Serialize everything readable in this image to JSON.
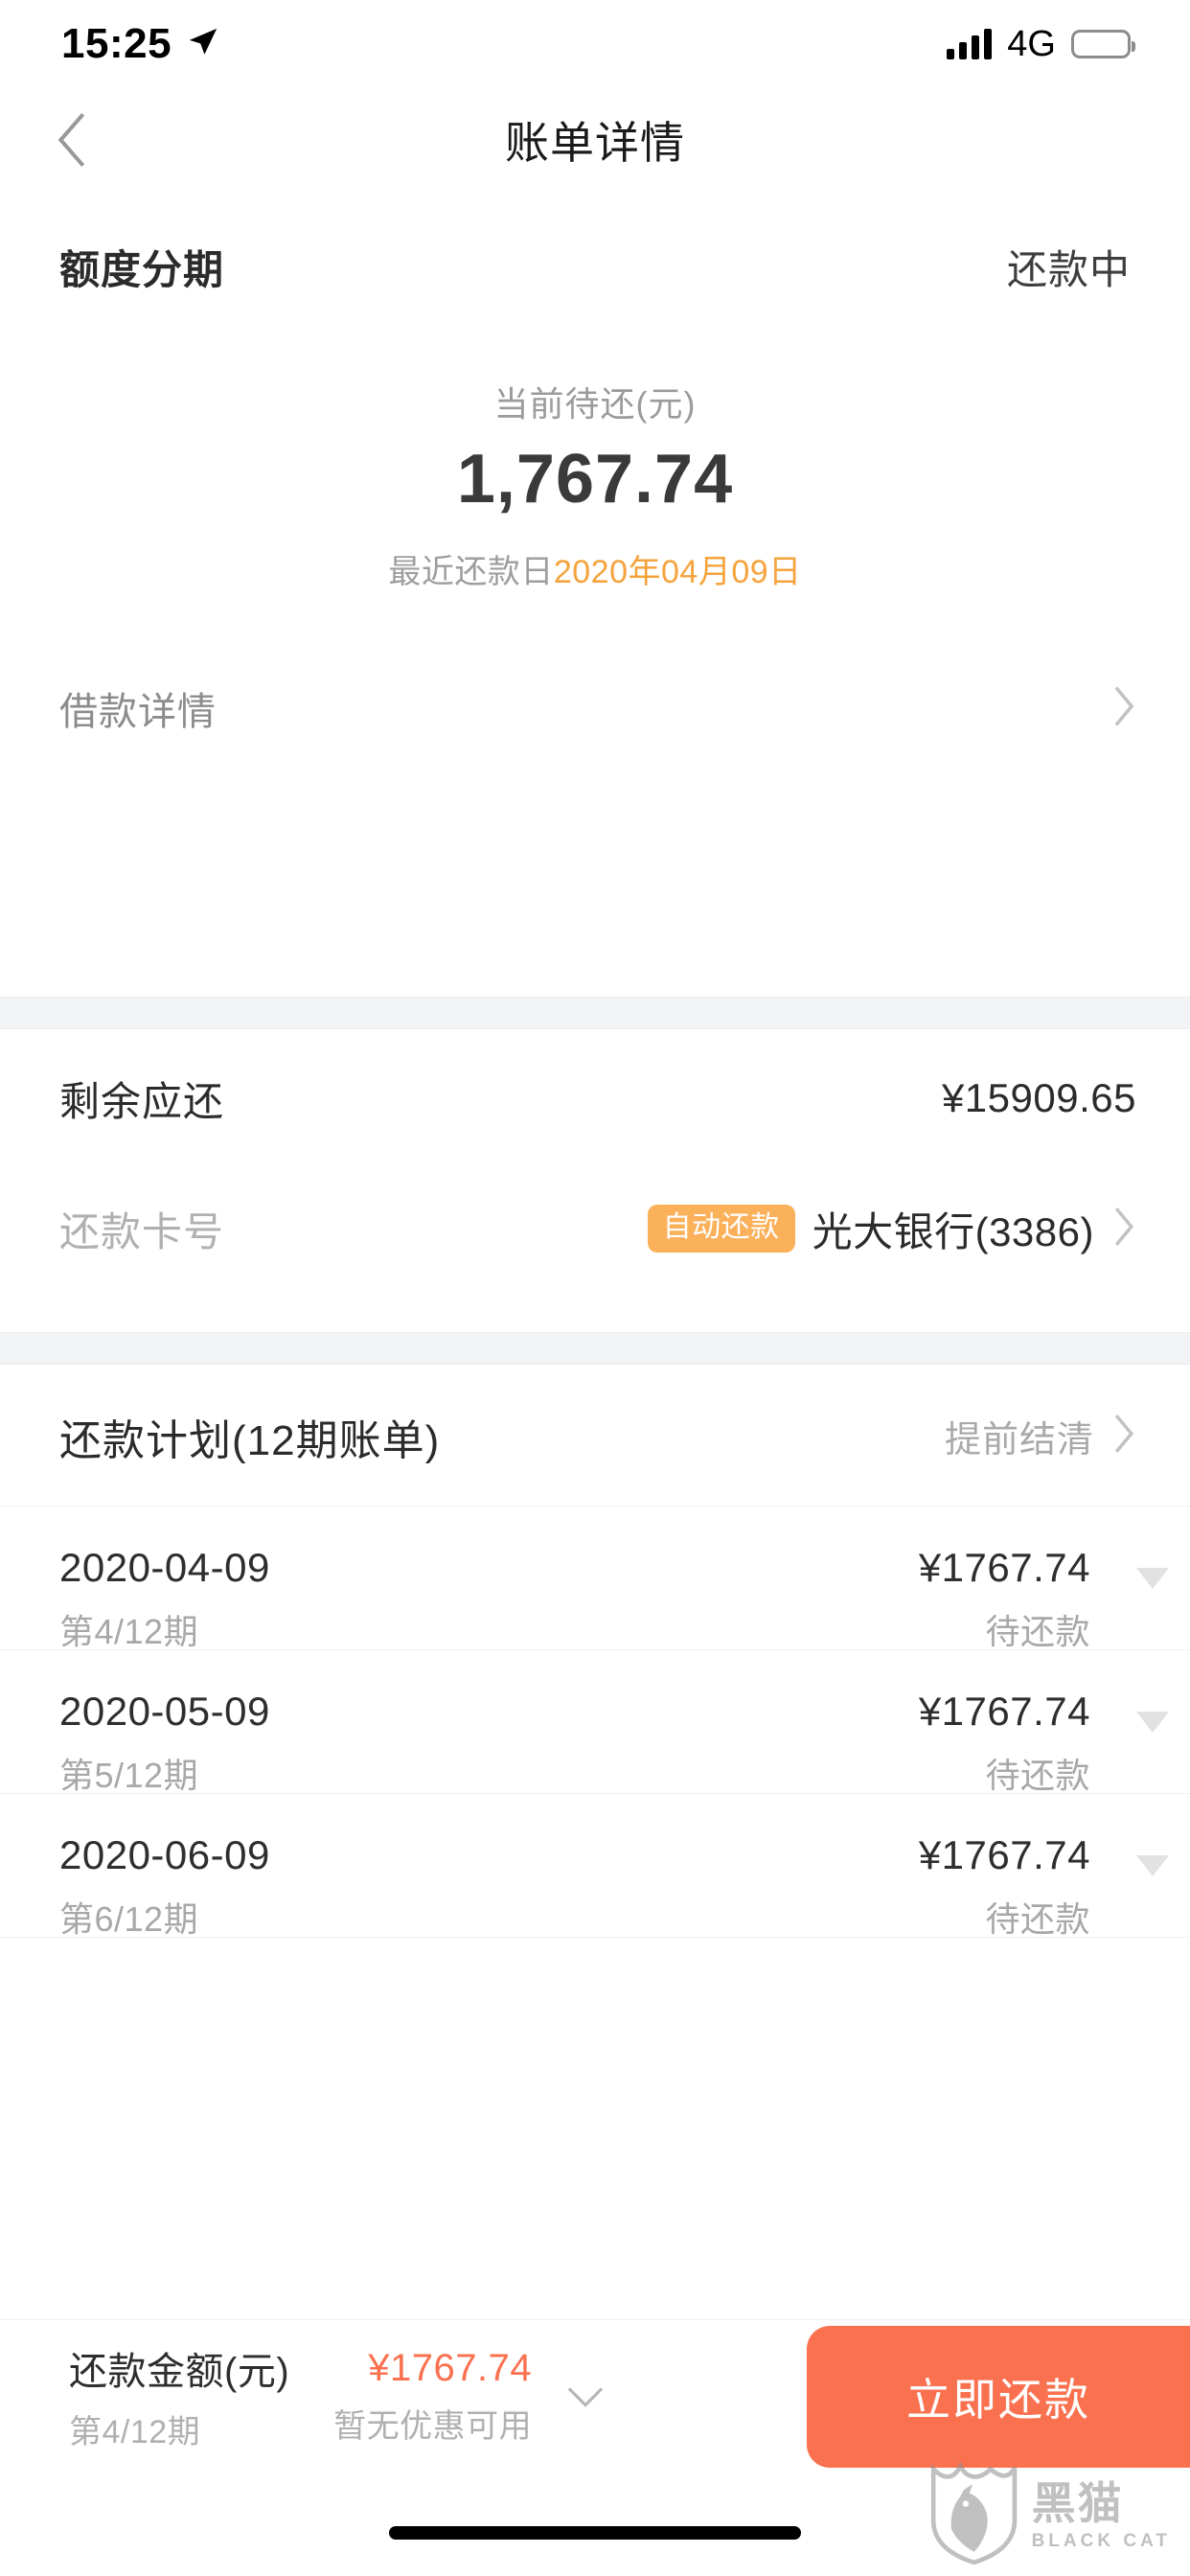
{
  "status_bar": {
    "time": "15:25",
    "location_icon": "location-arrow-icon",
    "signal_icon": "signal-bars-icon",
    "network": "4G",
    "battery_icon": "battery-icon"
  },
  "nav": {
    "back_icon": "chevron-left-icon",
    "title": "账单详情"
  },
  "summary": {
    "product_name": "额度分期",
    "status": "还款中",
    "amount_label": "当前待还(元)",
    "amount_value": "1,767.74",
    "due_label": "最近还款日",
    "due_date": "2020年04月09日",
    "due_date_color": "#f5a33c",
    "loan_detail_label": "借款详情",
    "loan_detail_icon": "chevron-right-icon"
  },
  "balance": {
    "remaining_label": "剩余应还",
    "remaining_value": "¥15909.65",
    "card_label": "还款卡号",
    "auto_badge": "自动还款",
    "auto_badge_color": "#fbb05a",
    "card_value": "光大银行(3386)",
    "card_icon": "chevron-right-icon"
  },
  "plan": {
    "title": "还款计划(12期账单)",
    "action": "提前结清",
    "action_icon": "chevron-right-icon",
    "installments": [
      {
        "date": "2020-04-09",
        "term": "第4/12期",
        "amount": "¥1767.74",
        "status": "待还款",
        "expand_icon": "triangle-down-icon"
      },
      {
        "date": "2020-05-09",
        "term": "第5/12期",
        "amount": "¥1767.74",
        "status": "待还款",
        "expand_icon": "triangle-down-icon"
      },
      {
        "date": "2020-06-09",
        "term": "第6/12期",
        "amount": "¥1767.74",
        "status": "待还款",
        "expand_icon": "triangle-down-icon"
      }
    ]
  },
  "bottom_bar": {
    "pay_label": "还款金额(元)",
    "pay_term": "第4/12期",
    "pay_amount": "¥1767.74",
    "pay_amount_color": "#fa7150",
    "promo_text": "暂无优惠可用",
    "expand_icon": "chevron-down-icon",
    "pay_button": "立即还款",
    "pay_button_color": "#fa7150"
  },
  "watermark": {
    "logo_icon": "black-cat-shield-icon",
    "name_cn": "黑猫",
    "name_en": "BLACK CAT"
  }
}
